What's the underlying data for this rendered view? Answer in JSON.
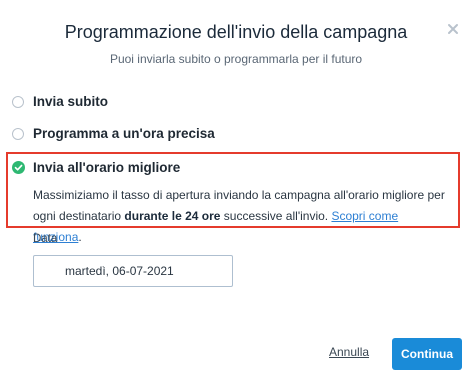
{
  "dialog": {
    "title": "Programmazione dell'invio della campagna",
    "subtitle": "Puoi inviarla subito o programmarla per il futuro",
    "close_icon": "close-icon"
  },
  "options": [
    {
      "label": "Invia subito",
      "selected": false
    },
    {
      "label": "Programma a un'ora precisa",
      "selected": false
    },
    {
      "label": "Invia all'orario migliore",
      "selected": true
    }
  ],
  "best_time": {
    "desc_1": "Massimiziamo il tasso di apertura inviando la campagna all'orario migliore per ogni destinatario ",
    "desc_bold": "durante le 24 ore",
    "desc_2": " successive all'invio. ",
    "link": "Scopri come funziona",
    "desc_end": ".",
    "highlight_color": "#e53b2c"
  },
  "date": {
    "label": "Data",
    "value": "martedì, 06-07-2021"
  },
  "footer": {
    "cancel_label": "Annulla",
    "continue_label": "Continua",
    "accent": "#1a8bd8"
  }
}
